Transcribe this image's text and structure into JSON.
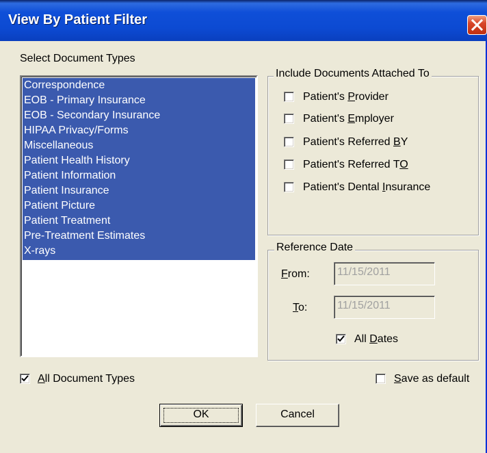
{
  "window": {
    "title": "View By Patient Filter"
  },
  "doc_types": {
    "label": "Select Document Types",
    "items": [
      "Correspondence",
      "EOB - Primary Insurance",
      "EOB - Secondary Insurance",
      "HIPAA Privacy/Forms",
      "Miscellaneous",
      "Patient Health History",
      "Patient Information",
      "Patient Insurance",
      "Patient Picture",
      "Patient Treatment",
      "Pre-Treatment Estimates",
      "X-rays"
    ],
    "all_label_u": "A",
    "all_label_rest": "ll Document Types",
    "all_checked": true
  },
  "attached": {
    "legend": "Include Documents Attached To",
    "provider": {
      "pre": "Patient's ",
      "u": "P",
      "post": "rovider"
    },
    "employer": {
      "pre": "Patient's ",
      "u": "E",
      "post": "mployer"
    },
    "referred_by": {
      "pre": "Patient's Referred ",
      "u": "B",
      "post": "Y"
    },
    "referred_to": {
      "pre": "Patient's Referred T",
      "u": "O",
      "post": ""
    },
    "dental": {
      "pre": "Patient's Dental ",
      "u": "I",
      "post": "nsurance"
    }
  },
  "reference_date": {
    "legend": "Reference Date",
    "from_u": "F",
    "from_rest": "rom:",
    "from_value": "11/15/2011",
    "to_u": "T",
    "to_rest": "o:",
    "to_value": "11/15/2011",
    "all_u": "D",
    "all_pre": "All ",
    "all_rest": "ates",
    "all_checked": true
  },
  "save_default": {
    "u": "S",
    "rest": "ave as default",
    "checked": false
  },
  "buttons": {
    "ok": "OK",
    "cancel": "Cancel"
  },
  "colors": {
    "selection": "#3B5AAE",
    "title_bar": "#0C4AD2",
    "close": "#D8462A"
  }
}
